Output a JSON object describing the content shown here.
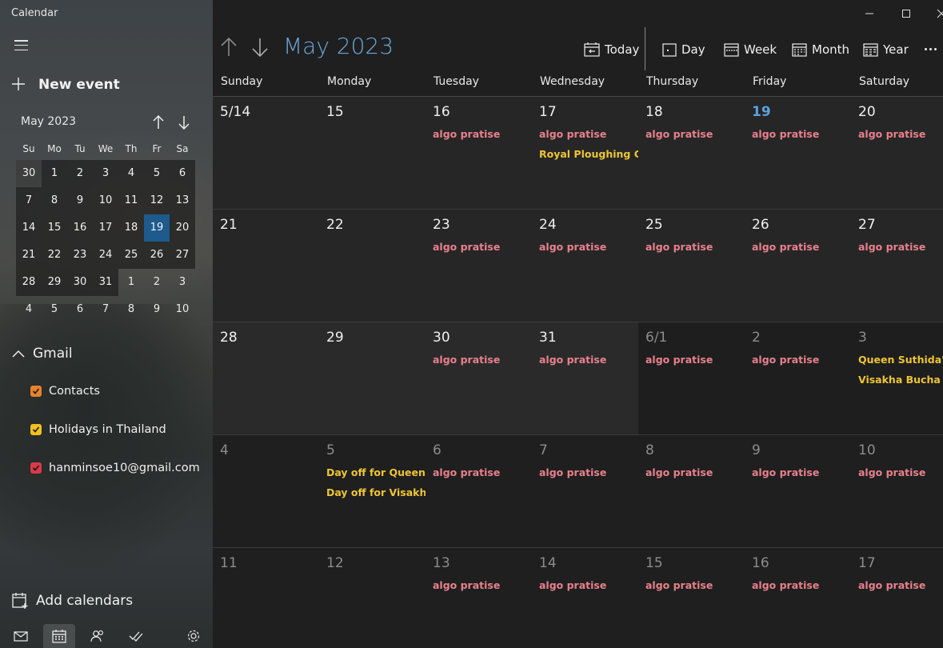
{
  "app": {
    "title": "Calendar"
  },
  "sidebar": {
    "new_event": "New event",
    "mini": {
      "title": "May 2023",
      "dows": [
        "Su",
        "Mo",
        "Tu",
        "We",
        "Th",
        "Fr",
        "Sa"
      ],
      "rows": [
        [
          "30",
          "1",
          "2",
          "3",
          "4",
          "5",
          "6"
        ],
        [
          "7",
          "8",
          "9",
          "10",
          "11",
          "12",
          "13"
        ],
        [
          "14",
          "15",
          "16",
          "17",
          "18",
          "19",
          "20"
        ],
        [
          "21",
          "22",
          "23",
          "24",
          "25",
          "26",
          "27"
        ],
        [
          "28",
          "29",
          "30",
          "31",
          "1",
          "2",
          "3"
        ],
        [
          "4",
          "5",
          "6",
          "7",
          "8",
          "9",
          "10"
        ]
      ],
      "today": "19"
    },
    "group": "Gmail",
    "calendars": [
      {
        "label": "Contacts",
        "color": "#e8832a"
      },
      {
        "label": "Holidays in Thailand",
        "color": "#f2c21b"
      },
      {
        "label": "hanminsoe10@gmail.com",
        "color": "#d93a47"
      }
    ],
    "add_calendars": "Add calendars"
  },
  "header": {
    "title": "May 2023",
    "today": "Today",
    "day": "Day",
    "week": "Week",
    "month": "Month",
    "year": "Year"
  },
  "weekdays": [
    "Sunday",
    "Monday",
    "Tuesday",
    "Wednesday",
    "Thursday",
    "Friday",
    "Saturday"
  ],
  "weeks": [
    [
      {
        "d": "5/14",
        "events": []
      },
      {
        "d": "15",
        "events": []
      },
      {
        "d": "16",
        "events": [
          {
            "t": "algo pratise",
            "c": "red"
          }
        ]
      },
      {
        "d": "17",
        "events": [
          {
            "t": "algo pratise",
            "c": "red"
          },
          {
            "t": "Royal Ploughing Ce",
            "c": "yellow"
          }
        ]
      },
      {
        "d": "18",
        "events": [
          {
            "t": "algo pratise",
            "c": "red"
          }
        ]
      },
      {
        "d": "19",
        "events": [
          {
            "t": "algo pratise",
            "c": "red"
          }
        ]
      },
      {
        "d": "20",
        "events": [
          {
            "t": "algo pratise",
            "c": "red"
          }
        ]
      }
    ],
    [
      {
        "d": "21",
        "events": []
      },
      {
        "d": "22",
        "events": []
      },
      {
        "d": "23",
        "events": [
          {
            "t": "algo pratise",
            "c": "red"
          }
        ]
      },
      {
        "d": "24",
        "events": [
          {
            "t": "algo pratise",
            "c": "red"
          }
        ]
      },
      {
        "d": "25",
        "events": [
          {
            "t": "algo pratise",
            "c": "red"
          }
        ]
      },
      {
        "d": "26",
        "events": [
          {
            "t": "algo pratise",
            "c": "red"
          }
        ]
      },
      {
        "d": "27",
        "events": [
          {
            "t": "algo pratise",
            "c": "red"
          }
        ]
      }
    ],
    [
      {
        "d": "28",
        "events": []
      },
      {
        "d": "29",
        "events": []
      },
      {
        "d": "30",
        "events": [
          {
            "t": "algo pratise",
            "c": "red"
          }
        ]
      },
      {
        "d": "31",
        "events": [
          {
            "t": "algo pratise",
            "c": "red"
          }
        ]
      },
      {
        "d": "6/1",
        "events": [
          {
            "t": "algo pratise",
            "c": "red"
          }
        ]
      },
      {
        "d": "2",
        "events": [
          {
            "t": "algo pratise",
            "c": "red"
          }
        ]
      },
      {
        "d": "3",
        "events": [
          {
            "t": "Queen Suthida's B",
            "c": "yellow"
          },
          {
            "t": "Visakha Bucha",
            "c": "yellow"
          }
        ]
      }
    ],
    [
      {
        "d": "4",
        "events": []
      },
      {
        "d": "5",
        "events": [
          {
            "t": "Day off for Queen S",
            "c": "yellow"
          },
          {
            "t": "Day off for Visakha",
            "c": "yellow"
          }
        ]
      },
      {
        "d": "6",
        "events": [
          {
            "t": "algo pratise",
            "c": "red"
          }
        ]
      },
      {
        "d": "7",
        "events": [
          {
            "t": "algo pratise",
            "c": "red"
          }
        ]
      },
      {
        "d": "8",
        "events": [
          {
            "t": "algo pratise",
            "c": "red"
          }
        ]
      },
      {
        "d": "9",
        "events": [
          {
            "t": "algo pratise",
            "c": "red"
          }
        ]
      },
      {
        "d": "10",
        "events": [
          {
            "t": "algo pratise",
            "c": "red"
          }
        ]
      }
    ],
    [
      {
        "d": "11",
        "events": []
      },
      {
        "d": "12",
        "events": []
      },
      {
        "d": "13",
        "events": [
          {
            "t": "algo pratise",
            "c": "red"
          }
        ]
      },
      {
        "d": "14",
        "events": [
          {
            "t": "algo pratise",
            "c": "red"
          }
        ]
      },
      {
        "d": "15",
        "events": [
          {
            "t": "algo pratise",
            "c": "red"
          }
        ]
      },
      {
        "d": "16",
        "events": [
          {
            "t": "algo pratise",
            "c": "red"
          }
        ]
      },
      {
        "d": "17",
        "events": [
          {
            "t": "algo pratise",
            "c": "red"
          }
        ]
      }
    ]
  ]
}
